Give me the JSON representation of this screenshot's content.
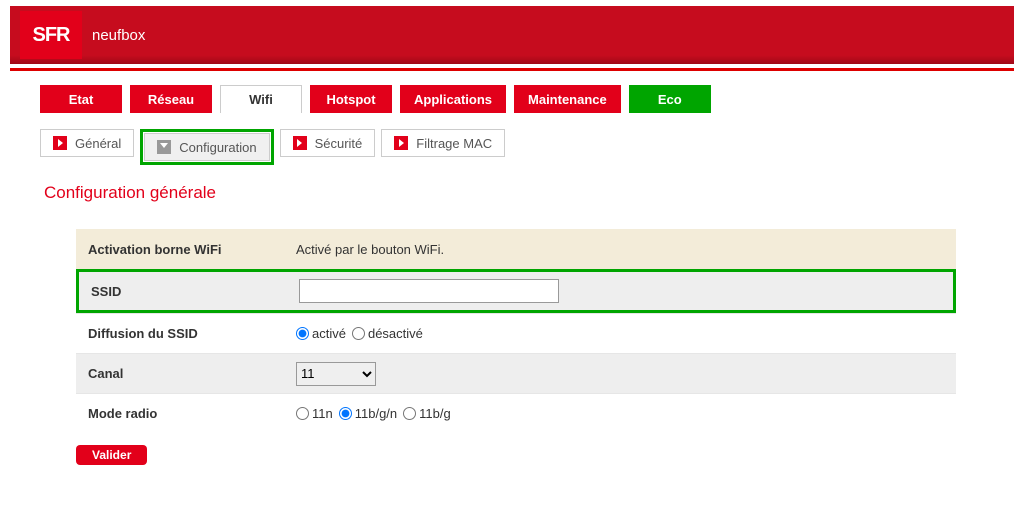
{
  "header": {
    "logo": "SFR",
    "product": "neufbox"
  },
  "main_tabs": [
    {
      "label": "Etat",
      "style": "red"
    },
    {
      "label": "Réseau",
      "style": "red"
    },
    {
      "label": "Wifi",
      "style": "active"
    },
    {
      "label": "Hotspot",
      "style": "red"
    },
    {
      "label": "Applications",
      "style": "red"
    },
    {
      "label": "Maintenance",
      "style": "red"
    },
    {
      "label": "Eco",
      "style": "green"
    }
  ],
  "sub_tabs": {
    "general": "Général",
    "configuration": "Configuration",
    "securite": "Sécurité",
    "filtrage": "Filtrage MAC"
  },
  "section_title": "Configuration générale",
  "rows": {
    "activation": {
      "label": "Activation borne WiFi",
      "value": "Activé par le bouton WiFi."
    },
    "ssid": {
      "label": "SSID",
      "value": ""
    },
    "diffusion": {
      "label": "Diffusion du SSID",
      "opt_active": "activé",
      "opt_desactive": "désactivé",
      "selected": "activé"
    },
    "canal": {
      "label": "Canal",
      "value": "11"
    },
    "mode_radio": {
      "label": "Mode radio",
      "opt_11n": "11n",
      "opt_11bgn": "11b/g/n",
      "opt_11bg": "11b/g",
      "selected": "11b/g/n"
    }
  },
  "buttons": {
    "valider": "Valider"
  }
}
